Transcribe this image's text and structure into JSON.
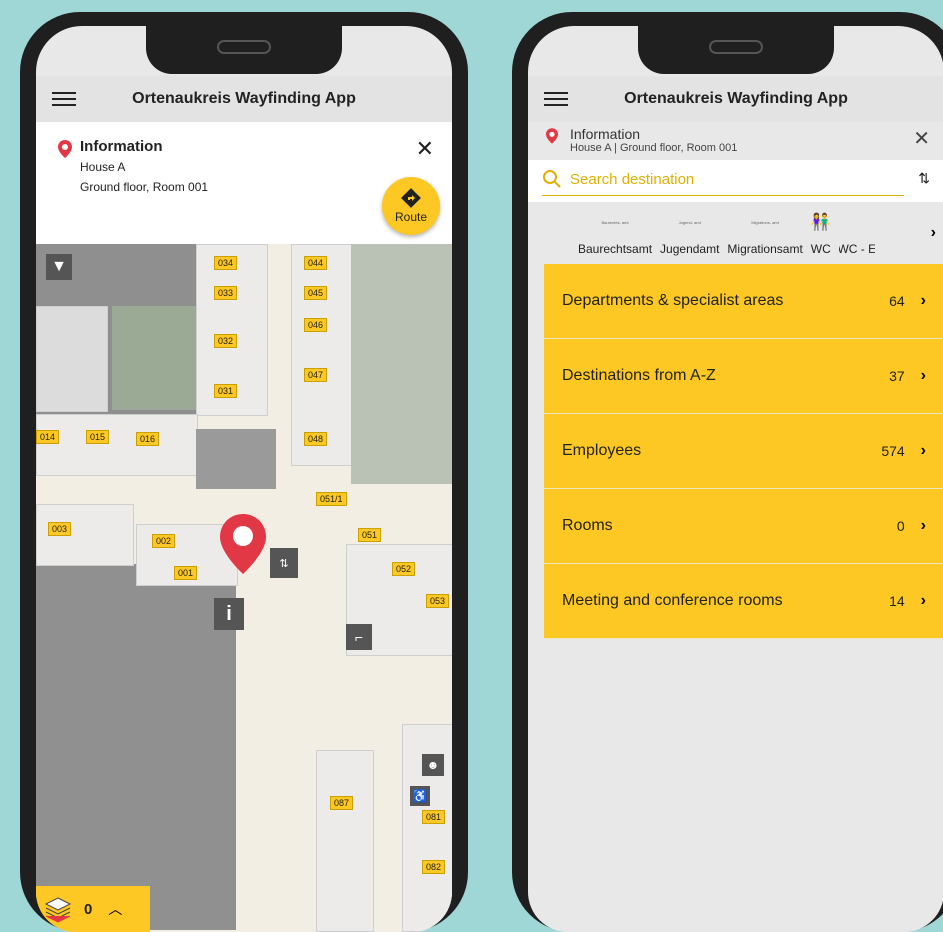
{
  "app": {
    "title": "Ortenaukreis Wayfinding App"
  },
  "left": {
    "info": {
      "title": "Information",
      "building": "House A",
      "location": "Ground floor, Room 001"
    },
    "route_label": "Route",
    "floor": {
      "level": "0"
    },
    "rooms": [
      "034",
      "033",
      "032",
      "031",
      "044",
      "045",
      "046",
      "047",
      "048",
      "014",
      "015",
      "016",
      "003",
      "002",
      "001",
      "051/1",
      "051",
      "052",
      "053",
      "087",
      "081",
      "082"
    ]
  },
  "right": {
    "info": {
      "title": "Information",
      "subtitle": "House A | Ground floor, Room 001"
    },
    "search": {
      "placeholder": "Search destination"
    },
    "quick_links": [
      "Baurechtsamt",
      "Jugendamt",
      "Migrationsamt",
      "WC",
      "WC - E"
    ],
    "quick_mini": [
      "Baurechts-\namt",
      "Jugend-\namt",
      "Migrations-\namt"
    ],
    "categories": [
      {
        "name": "Departments & specialist areas",
        "count": "64"
      },
      {
        "name": "Destinations from A-Z",
        "count": "37"
      },
      {
        "name": "Employees",
        "count": "574"
      },
      {
        "name": "Rooms",
        "count": "0"
      },
      {
        "name": "Meeting and conference rooms",
        "count": "14"
      }
    ]
  },
  "colors": {
    "accent": "#fdc824",
    "pin": "#e23744",
    "background": "#9fd6d6"
  }
}
